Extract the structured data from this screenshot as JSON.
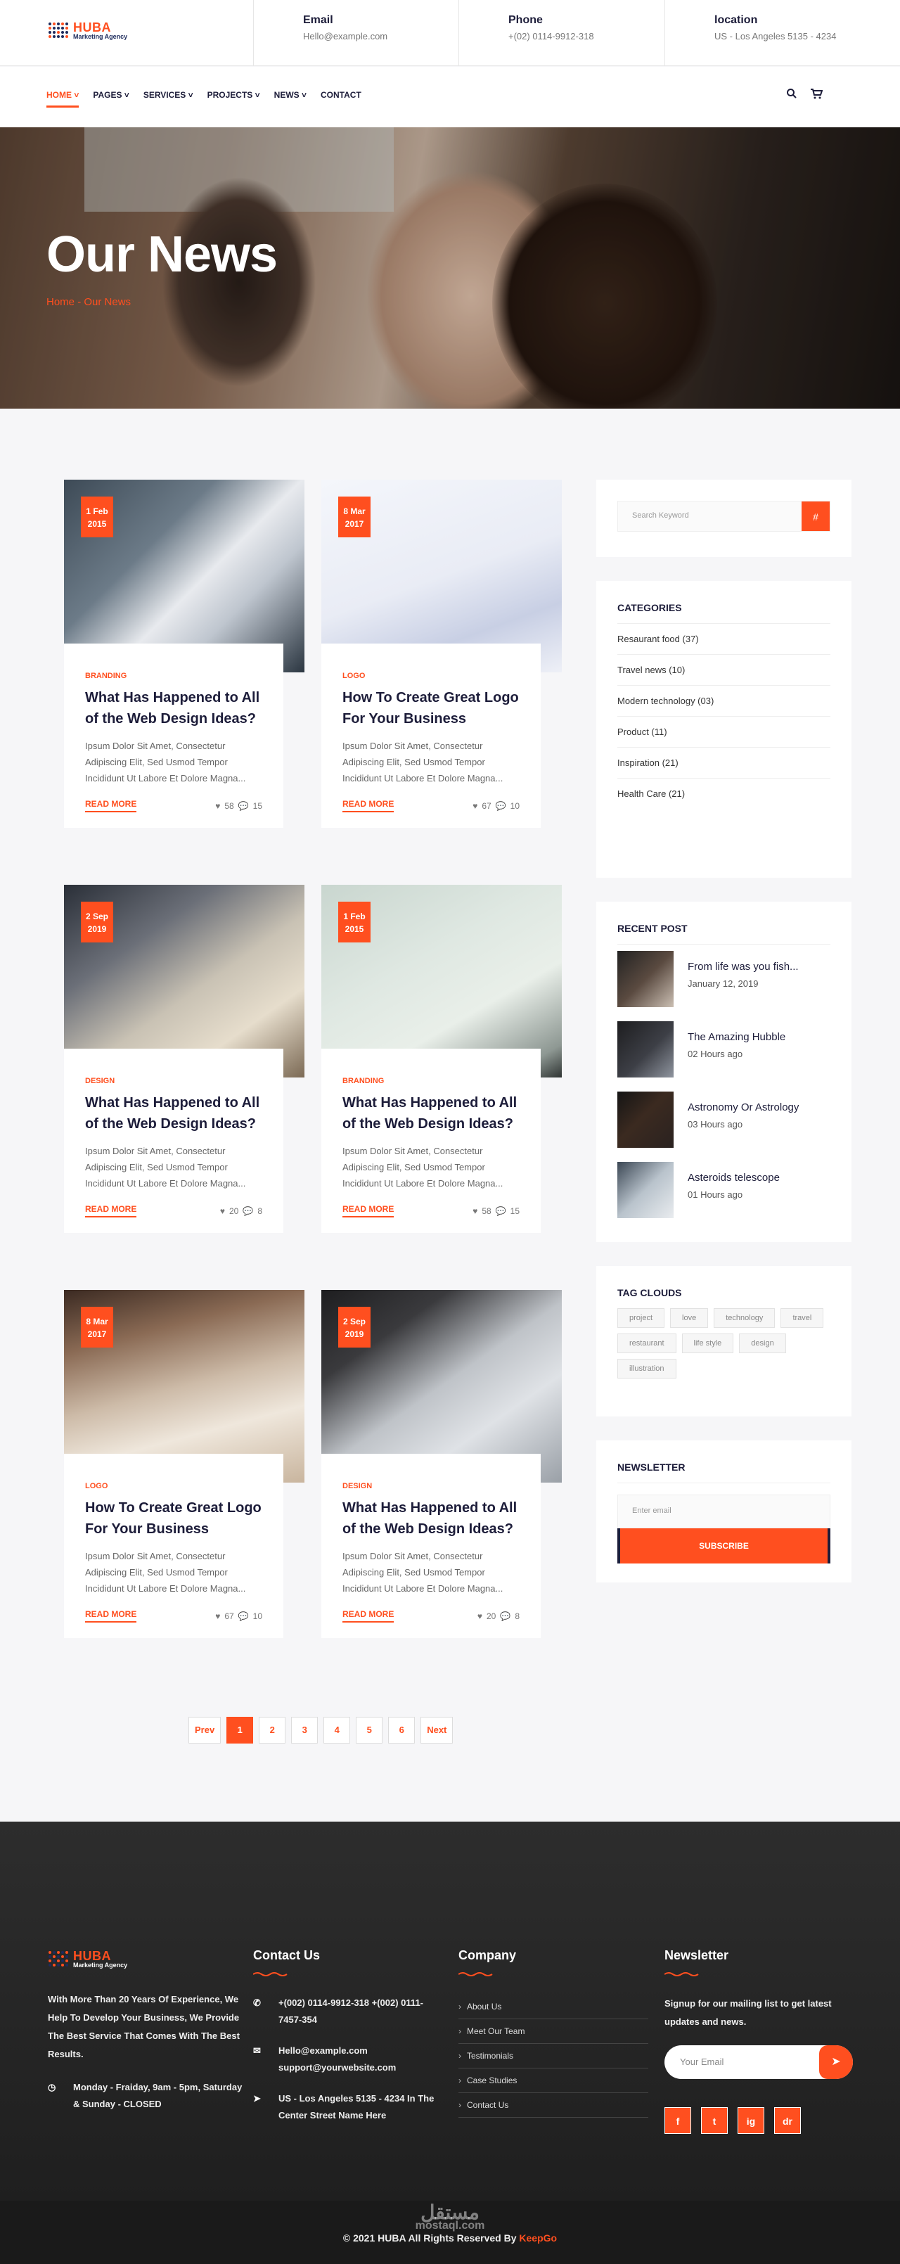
{
  "brand": {
    "name": "HUBA",
    "tagline": "Marketing Agency"
  },
  "topbar": {
    "email": {
      "title": "Email",
      "value": "Hello@example.com"
    },
    "phone": {
      "title": "Phone",
      "value": "+(02) 0114-9912-318"
    },
    "location": {
      "title": "location",
      "value": "US - Los Angeles 5135 - 4234"
    }
  },
  "nav": {
    "items": [
      "HOME",
      "PAGES",
      "SERVICES",
      "PROJECTS",
      "NEWS",
      "CONTACT"
    ]
  },
  "hero": {
    "title": "Our News",
    "crumb_home": "Home",
    "crumb_sep": "-",
    "crumb_current": "Our News"
  },
  "posts": [
    {
      "day": "1 Feb",
      "year": "2015",
      "category": "BRANDING",
      "title": "What Has Happened to All of the Web Design Ideas?",
      "desc": "Ipsum Dolor Sit Amet, Consectetur Adipiscing Elit, Sed Usmod Tempor Incididunt Ut Labore Et Dolore Magna...",
      "more": "READ MORE",
      "likes": "58",
      "comments": "15"
    },
    {
      "day": "8 Mar",
      "year": "2017",
      "category": "LOGO",
      "title": "How To Create Great Logo For Your Business",
      "desc": "Ipsum Dolor Sit Amet, Consectetur Adipiscing Elit, Sed Usmod Tempor Incididunt Ut Labore Et Dolore Magna...",
      "more": "READ MORE",
      "likes": "67",
      "comments": "10"
    },
    {
      "day": "2 Sep",
      "year": "2019",
      "category": "DESIGN",
      "title": "What Has Happened to All of the Web Design Ideas?",
      "desc": "Ipsum Dolor Sit Amet, Consectetur Adipiscing Elit, Sed Usmod Tempor Incididunt Ut Labore Et Dolore Magna...",
      "more": "READ MORE",
      "likes": "20",
      "comments": "8"
    },
    {
      "day": "1 Feb",
      "year": "2015",
      "category": "BRANDING",
      "title": "What Has Happened to All of the Web Design Ideas?",
      "desc": "Ipsum Dolor Sit Amet, Consectetur Adipiscing Elit, Sed Usmod Tempor Incididunt Ut Labore Et Dolore Magna...",
      "more": "READ MORE",
      "likes": "58",
      "comments": "15"
    },
    {
      "day": "8 Mar",
      "year": "2017",
      "category": "LOGO",
      "title": "How To Create Great Logo For Your Business",
      "desc": "Ipsum Dolor Sit Amet, Consectetur Adipiscing Elit, Sed Usmod Tempor Incididunt Ut Labore Et Dolore Magna...",
      "more": "READ MORE",
      "likes": "67",
      "comments": "10"
    },
    {
      "day": "2 Sep",
      "year": "2019",
      "category": "DESIGN",
      "title": "What Has Happened to All of the Web Design Ideas?",
      "desc": "Ipsum Dolor Sit Amet, Consectetur Adipiscing Elit, Sed Usmod Tempor Incididunt Ut Labore Et Dolore Magna...",
      "more": "READ MORE",
      "likes": "20",
      "comments": "8"
    }
  ],
  "pager": {
    "prev": "Prev",
    "pages": [
      "1",
      "2",
      "3",
      "4",
      "5",
      "6"
    ],
    "next": "Next"
  },
  "sidebar": {
    "search_placeholder": "Search Keyword",
    "search_icon": "#",
    "categories_title": "CATEGORIES",
    "categories": [
      "Resaurant food (37)",
      "Travel news (10)",
      "Modern technology (03)",
      "Product (11)",
      "Inspiration (21)",
      "Health Care (21)"
    ],
    "recent_title": "RECENT POST",
    "recent": [
      {
        "title": "From life was you fish...",
        "date": "January 12, 2019"
      },
      {
        "title": "The Amazing Hubble",
        "date": "02 Hours ago"
      },
      {
        "title": "Astronomy Or Astrology",
        "date": "03 Hours ago"
      },
      {
        "title": "Asteroids telescope",
        "date": "01 Hours ago"
      }
    ],
    "tags_title": "TAG CLOUDS",
    "tags": [
      "project",
      "love",
      "technology",
      "travel",
      "restaurant",
      "life style",
      "design",
      "illustration"
    ],
    "newsletter_title": "NEWSLETTER",
    "newsletter_placeholder": "Enter email",
    "newsletter_button": "SUBSCRIBE"
  },
  "footer": {
    "about": "With More Than 20 Years Of Experience, We Help To Develop Your Business, We Provide The Best Service That Comes With The Best Results.",
    "hours": "Monday - Fraiday, 9am - 5pm, Saturday & Sunday - CLOSED",
    "contact_title": "Contact Us",
    "phones": "+(002) 0114-9912-318 +(002) 0111-7457-354",
    "emails": "Hello@example.com support@yourwebsite.com",
    "address": "US - Los Angeles 5135 - 4234 In The Center Street Name Here",
    "company_title": "Company",
    "company_links": [
      "About Us",
      "Meet Our Team",
      "Testimonials",
      "Case Studies",
      "Contact Us"
    ],
    "newsletter_title": "Newsletter",
    "newsletter_text": "Signup for our mailing list to get latest updates and news.",
    "newsletter_placeholder": "Your Email",
    "socials": [
      "f",
      "t",
      "ig",
      "dr"
    ]
  },
  "copyright": {
    "text": "© 2021 HUBA All Rights Reserved By",
    "author": "KeepGo"
  },
  "watermark": {
    "ar": "مستقل",
    "url": "mostaql.com"
  },
  "colors": {
    "accent": "#ff4f1f",
    "dark": "#1d1d3a"
  }
}
